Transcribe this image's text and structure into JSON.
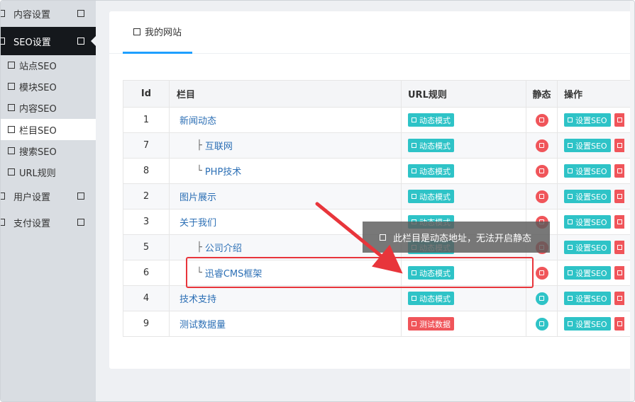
{
  "sidebar": {
    "items": [
      {
        "label": "内容设置",
        "type": "parent"
      },
      {
        "label": "SEO设置",
        "type": "parent-active"
      },
      {
        "label": "站点SEO",
        "type": "sub"
      },
      {
        "label": "模块SEO",
        "type": "sub"
      },
      {
        "label": "内容SEO",
        "type": "sub"
      },
      {
        "label": "栏目SEO",
        "type": "sub-current"
      },
      {
        "label": "搜索SEO",
        "type": "sub"
      },
      {
        "label": "URL规则",
        "type": "sub"
      },
      {
        "label": "用户设置",
        "type": "parent"
      },
      {
        "label": "支付设置",
        "type": "parent"
      }
    ]
  },
  "tab": {
    "label": "我的网站"
  },
  "table": {
    "headers": {
      "id": "Id",
      "name": "栏目",
      "url": "URL规则",
      "static": "静态",
      "op": "操作"
    },
    "rows": [
      {
        "id": "1",
        "prefix": "",
        "name": "新闻动态",
        "url": "动态模式",
        "url_color": "teal",
        "static": "red"
      },
      {
        "id": "7",
        "prefix": "├ ",
        "name": "互联网",
        "url": "动态模式",
        "url_color": "teal",
        "static": "red"
      },
      {
        "id": "8",
        "prefix": "└ ",
        "name": "PHP技术",
        "url": "动态模式",
        "url_color": "teal",
        "static": "red"
      },
      {
        "id": "2",
        "prefix": "",
        "name": "图片展示",
        "url": "动态模式",
        "url_color": "teal",
        "static": "red"
      },
      {
        "id": "3",
        "prefix": "",
        "name": "关于我们",
        "url": "动态模式",
        "url_color": "teal",
        "static": "red"
      },
      {
        "id": "5",
        "prefix": "├ ",
        "name": "公司介绍",
        "url": "动态模式",
        "url_color": "teal",
        "static": "red"
      },
      {
        "id": "6",
        "prefix": "└ ",
        "name": "迅睿CMS框架",
        "url": "动态模式",
        "url_color": "teal",
        "static": "red"
      },
      {
        "id": "4",
        "prefix": "",
        "name": "技术支持",
        "url": "动态模式",
        "url_color": "teal",
        "static": "teal"
      },
      {
        "id": "9",
        "prefix": "",
        "name": "测试数据量",
        "url": "测试数据",
        "url_color": "red",
        "static": "teal"
      }
    ],
    "op_label": "设置SEO"
  },
  "tooltip": {
    "text": "此栏目是动态地址，无法开启静态"
  },
  "colors": {
    "teal": "#2ec3c7",
    "red": "#f0555a",
    "link": "#2c6fb5",
    "active_bg": "#15181c",
    "tab_underline": "#1e9fff",
    "annotation": "#e8353b"
  }
}
